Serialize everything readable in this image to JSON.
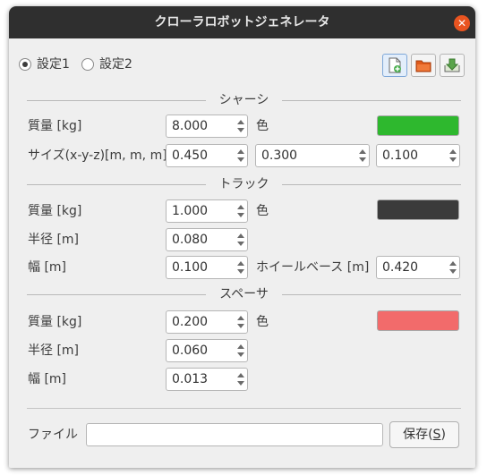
{
  "window": {
    "title": "クローラロボットジェネレータ"
  },
  "settings": {
    "option1": "設定1",
    "option2": "設定2",
    "selected": "設定1"
  },
  "toolbar": {
    "new_icon": "new-file-icon",
    "open_icon": "open-folder-icon",
    "save_icon": "download-save-icon"
  },
  "chassis": {
    "header": "シャーシ",
    "mass_label": "質量 [kg]",
    "mass_value": "8.000",
    "color_label": "色",
    "color": "#2eb82e",
    "size_label": "サイズ(x-y-z)[m, m, m]",
    "size_x": "0.450",
    "size_y": "0.300",
    "size_z": "0.100"
  },
  "track": {
    "header": "トラック",
    "mass_label": "質量 [kg]",
    "mass_value": "1.000",
    "color_label": "色",
    "color": "#3b3b3b",
    "radius_label": "半径 [m]",
    "radius_value": "0.080",
    "width_label": "幅 [m]",
    "width_value": "0.100",
    "wheelbase_label": "ホイールベース [m]",
    "wheelbase_value": "0.420"
  },
  "spacer": {
    "header": "スペーサ",
    "mass_label": "質量 [kg]",
    "mass_value": "0.200",
    "color_label": "色",
    "color": "#f26b6b",
    "radius_label": "半径 [m]",
    "radius_value": "0.060",
    "width_label": "幅 [m]",
    "width_value": "0.013"
  },
  "file": {
    "label": "ファイル",
    "value": "",
    "save_prefix": "保存(",
    "save_mnemonic": "S",
    "save_suffix": ")"
  }
}
